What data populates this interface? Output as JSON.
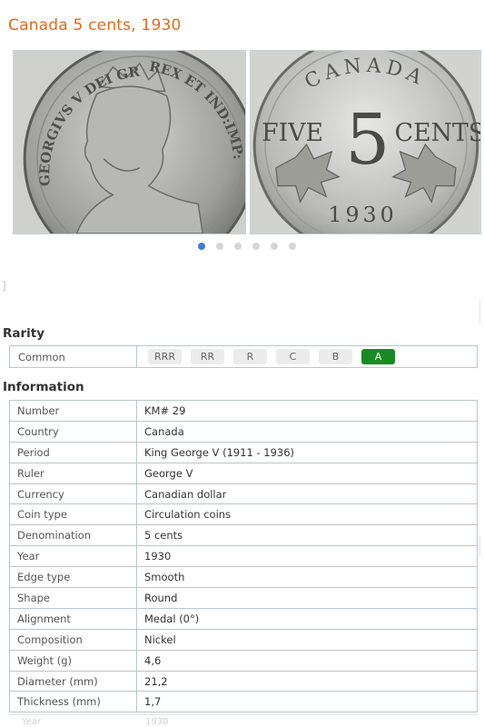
{
  "page": {
    "title": "Canada 5 cents, 1930"
  },
  "gallery": {
    "obverse": {
      "alt": "obverse",
      "legend_left": "GEORGIVS V DEI GRA:",
      "legend_right": "REX ET IND:IMP:"
    },
    "reverse": {
      "alt": "reverse",
      "top": "CANADA",
      "left": "FIVE",
      "center": "5",
      "right": "CENTS",
      "year": "1930"
    },
    "dots_count": 6,
    "active_dot": 1
  },
  "misc": {
    "bracket": "]"
  },
  "rarity": {
    "heading": "Rarity",
    "label": "Common",
    "scale": [
      "RRR",
      "RR",
      "R",
      "C",
      "B",
      "A"
    ],
    "active": "A",
    "colors": {
      "active": "#1b8a26",
      "inactive": "#ececec"
    }
  },
  "information": {
    "heading": "Information",
    "rows": [
      {
        "key": "Number",
        "value": "KM# 29"
      },
      {
        "key": "Country",
        "value": "Canada"
      },
      {
        "key": "Period",
        "value": "King George V (1911 - 1936)"
      },
      {
        "key": "Ruler",
        "value": "George V"
      },
      {
        "key": "Currency",
        "value": "Canadian dollar"
      },
      {
        "key": "Coin type",
        "value": "Circulation coins"
      },
      {
        "key": "Denomination",
        "value": "5 cents"
      },
      {
        "key": "Year",
        "value": "1930"
      },
      {
        "key": "Edge type",
        "value": "Smooth"
      },
      {
        "key": "Shape",
        "value": "Round"
      },
      {
        "key": "Alignment",
        "value": "Medal (0°)"
      },
      {
        "key": "Composition",
        "value": "Nickel"
      },
      {
        "key": "Weight (g)",
        "value": "4,6"
      },
      {
        "key": "Diameter (mm)",
        "value": "21,2"
      },
      {
        "key": "Thickness (mm)",
        "value": "1,7"
      }
    ],
    "faded_row": {
      "key": "Year",
      "value": "1930"
    }
  },
  "colors": {
    "title": "#e0691f",
    "border": "#b9c6d0",
    "dot_active": "#3f7fd0"
  }
}
